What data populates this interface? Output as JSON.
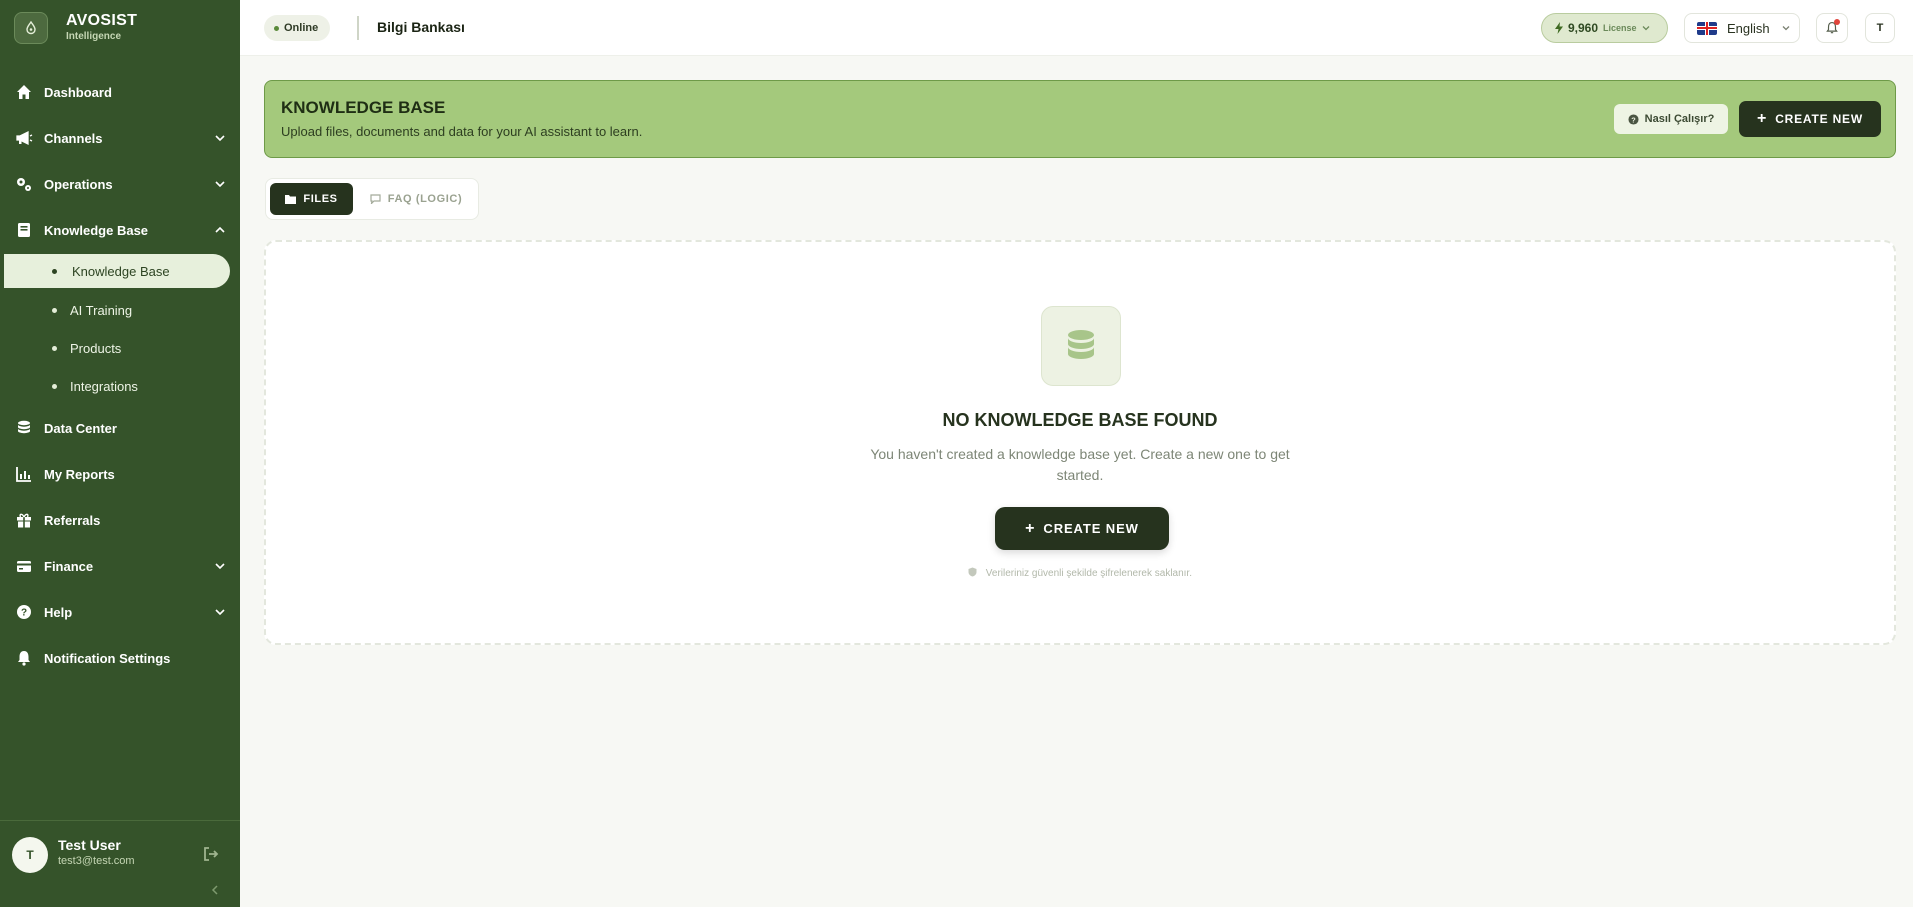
{
  "brand": {
    "title": "AVOSIST",
    "subtitle": "Intelligence"
  },
  "sidebar": {
    "items": [
      {
        "label": "Dashboard",
        "icon": "home-icon"
      },
      {
        "label": "Channels",
        "icon": "megaphone-icon",
        "expandable": true
      },
      {
        "label": "Operations",
        "icon": "gears-icon",
        "expandable": true
      },
      {
        "label": "Knowledge Base",
        "icon": "book-icon",
        "expandable": true,
        "expanded": true
      },
      {
        "label": "Data Center",
        "icon": "database-icon"
      },
      {
        "label": "My Reports",
        "icon": "chart-icon"
      },
      {
        "label": "Referrals",
        "icon": "gift-icon"
      },
      {
        "label": "Finance",
        "icon": "wallet-icon",
        "expandable": true
      },
      {
        "label": "Help",
        "icon": "help-icon",
        "expandable": true
      },
      {
        "label": "Notification Settings",
        "icon": "bell-icon"
      }
    ],
    "submenu": [
      {
        "label": "Knowledge Base",
        "active": true
      },
      {
        "label": "AI Training"
      },
      {
        "label": "Products"
      },
      {
        "label": "Integrations"
      }
    ]
  },
  "user": {
    "initial": "T",
    "name": "Test User",
    "email": "test3@test.com"
  },
  "header": {
    "status": "Online",
    "page_title": "Bilgi Bankası",
    "license_value": "9,960",
    "license_label": "License",
    "language": "English",
    "avatar_initial": "T"
  },
  "banner": {
    "title": "KNOWLEDGE BASE",
    "subtitle": "Upload files, documents and data for your AI assistant to learn.",
    "how_label": "Nasıl Çalışır?",
    "create_label": "CREATE NEW"
  },
  "tabs": {
    "files": "FILES",
    "faq": "FAQ (LOGIC)"
  },
  "empty_state": {
    "title": "NO KNOWLEDGE BASE FOUND",
    "description": "You haven't created a knowledge base yet. Create a new one to get started.",
    "create_label": "CREATE NEW",
    "security_note": "Verileriniz güvenli şekilde şifrelenerek saklanır."
  },
  "colors": {
    "sidebar_bg": "#35532a",
    "banner_bg": "#a4c97c",
    "primary_dark": "#26331e",
    "notification_dot": "#e0453b"
  }
}
